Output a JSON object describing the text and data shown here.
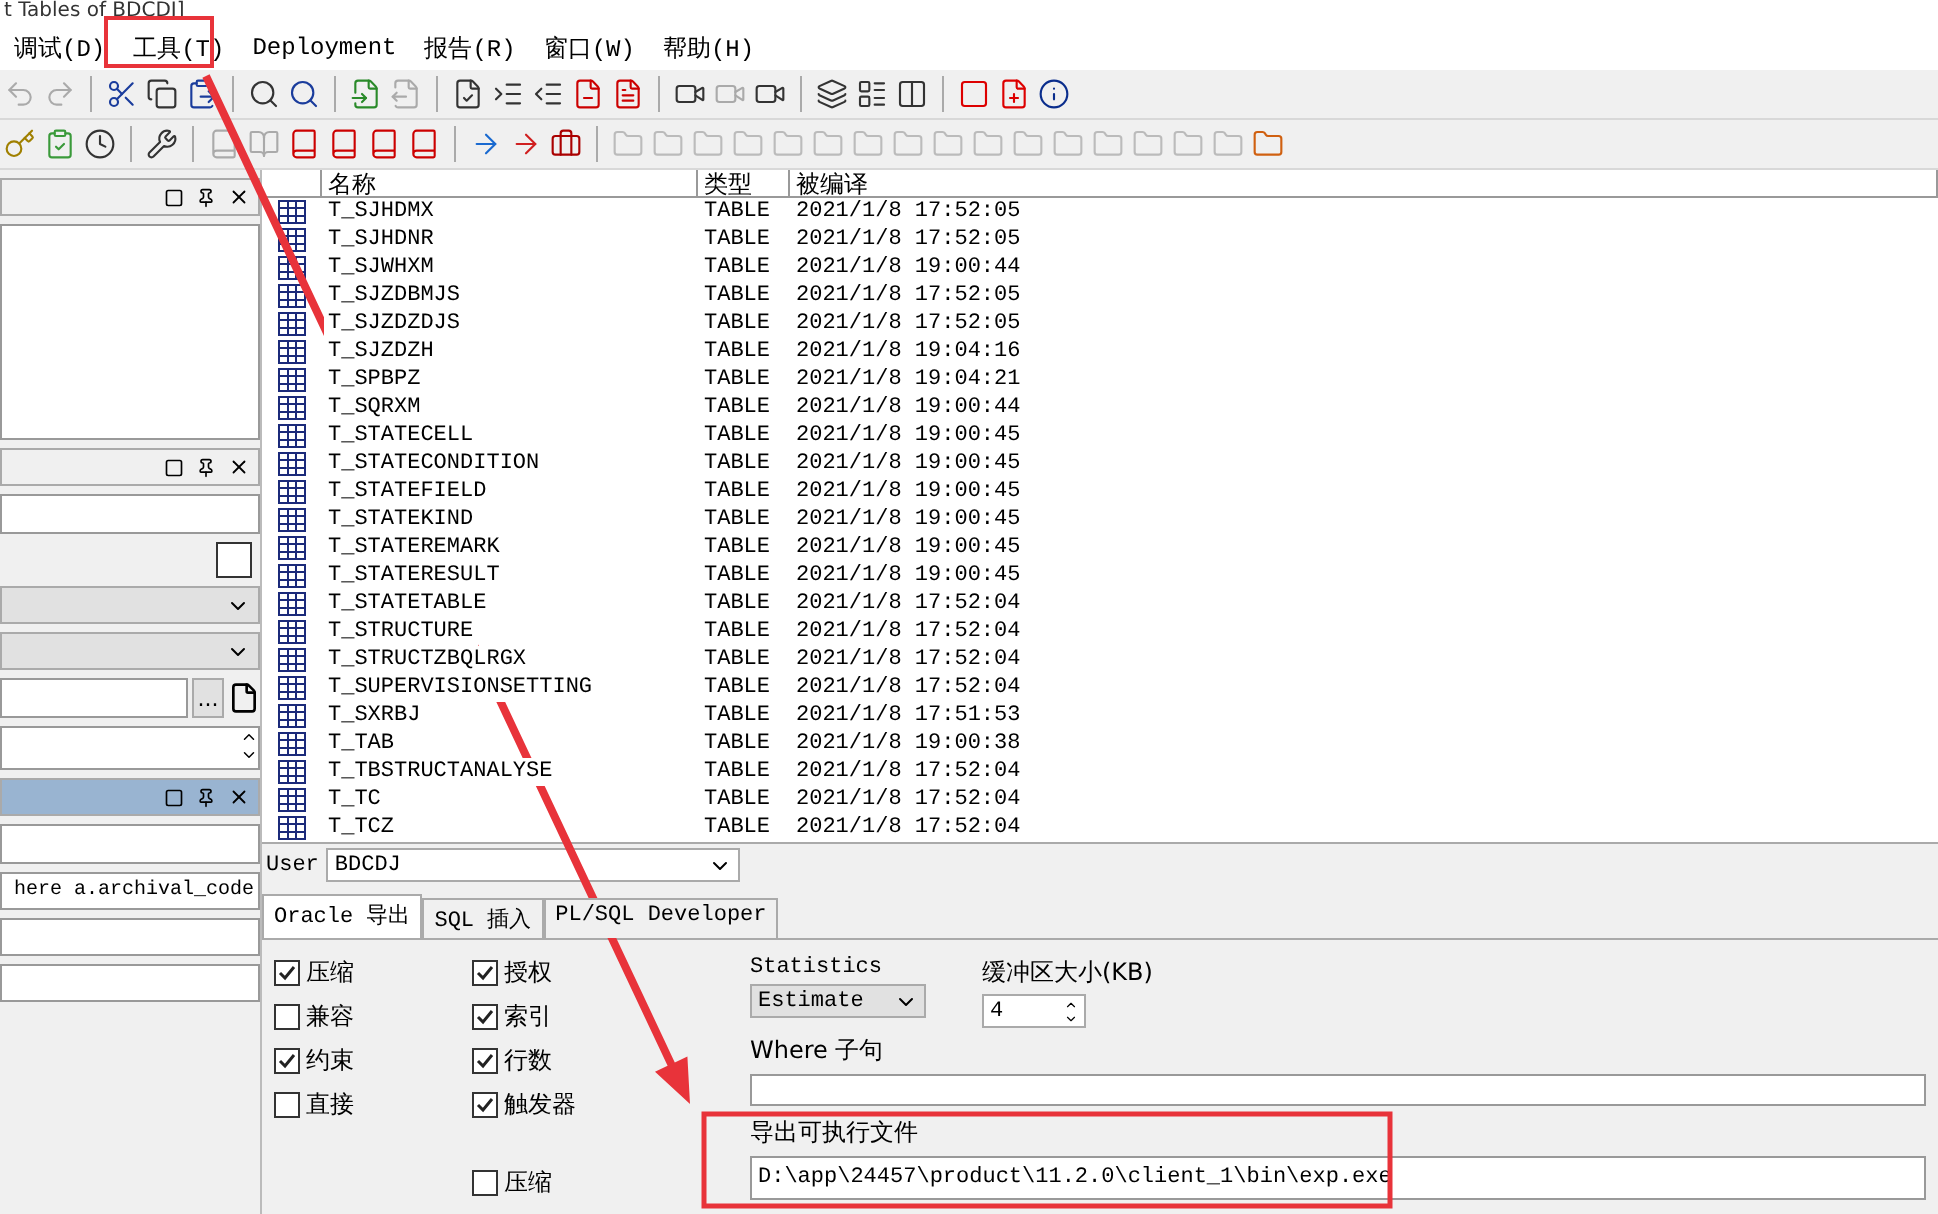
{
  "window": {
    "title": "t Tables of BDCDJ]"
  },
  "menu": [
    "调试(D)",
    "工具(T)",
    "Deployment",
    "报告(R)",
    "窗口(W)",
    "帮助(H)"
  ],
  "left_panels": [
    {
      "selected": false
    },
    {
      "selected": false,
      "checked": false,
      "browse_button": "..."
    },
    {
      "selected": true,
      "sql_text": "here a.archival_code"
    }
  ],
  "table": {
    "columns": [
      "名称",
      "类型",
      "被编译"
    ],
    "rows": [
      [
        "T_SJHDMX",
        "TABLE",
        "2021/1/8 17:52:05"
      ],
      [
        "T_SJHDNR",
        "TABLE",
        "2021/1/8 17:52:05"
      ],
      [
        "T_SJWHXM",
        "TABLE",
        "2021/1/8 19:00:44"
      ],
      [
        "T_SJZDBMJS",
        "TABLE",
        "2021/1/8 17:52:05"
      ],
      [
        "T_SJZDZDJS",
        "TABLE",
        "2021/1/8 17:52:05"
      ],
      [
        "T_SJZDZH",
        "TABLE",
        "2021/1/8 19:04:16"
      ],
      [
        "T_SPBPZ",
        "TABLE",
        "2021/1/8 19:04:21"
      ],
      [
        "T_SQRXM",
        "TABLE",
        "2021/1/8 19:00:44"
      ],
      [
        "T_STATECELL",
        "TABLE",
        "2021/1/8 19:00:45"
      ],
      [
        "T_STATECONDITION",
        "TABLE",
        "2021/1/8 19:00:45"
      ],
      [
        "T_STATEFIELD",
        "TABLE",
        "2021/1/8 19:00:45"
      ],
      [
        "T_STATEKIND",
        "TABLE",
        "2021/1/8 19:00:45"
      ],
      [
        "T_STATEREMARK",
        "TABLE",
        "2021/1/8 19:00:45"
      ],
      [
        "T_STATERESULT",
        "TABLE",
        "2021/1/8 19:00:45"
      ],
      [
        "T_STATETABLE",
        "TABLE",
        "2021/1/8 17:52:04"
      ],
      [
        "T_STRUCTURE",
        "TABLE",
        "2021/1/8 17:52:04"
      ],
      [
        "T_STRUCTZBQLRGX",
        "TABLE",
        "2021/1/8 17:52:04"
      ],
      [
        "T_SUPERVISIONSETTING",
        "TABLE",
        "2021/1/8 17:52:04"
      ],
      [
        "T_SXRBJ",
        "TABLE",
        "2021/1/8 17:51:53"
      ],
      [
        "T_TAB",
        "TABLE",
        "2021/1/8 19:00:38"
      ],
      [
        "T_TBSTRUCTANALYSE",
        "TABLE",
        "2021/1/8 17:52:04"
      ],
      [
        "T_TC",
        "TABLE",
        "2021/1/8 17:52:04"
      ],
      [
        "T_TCZ",
        "TABLE",
        "2021/1/8 17:52:04"
      ]
    ]
  },
  "user": {
    "label": "User",
    "value": "BDCDJ"
  },
  "tabs": [
    {
      "label": "Oracle 导出",
      "selected": true
    },
    {
      "label": "SQL 插入",
      "selected": false
    },
    {
      "label": "PL/SQL Developer",
      "selected": false
    }
  ],
  "options_left": [
    {
      "label": "压缩",
      "checked": true
    },
    {
      "label": "兼容",
      "checked": false
    },
    {
      "label": "约束",
      "checked": true
    },
    {
      "label": "直接",
      "checked": false
    }
  ],
  "options_right": [
    {
      "label": "授权",
      "checked": true
    },
    {
      "label": "索引",
      "checked": true
    },
    {
      "label": "行数",
      "checked": true
    },
    {
      "label": "触发器",
      "checked": true
    }
  ],
  "extra_option": {
    "label": "压缩",
    "checked": false
  },
  "statistics": {
    "label": "Statistics",
    "value": "Estimate"
  },
  "buffer": {
    "label": "缓冲区大小(KB)",
    "value": "4"
  },
  "where": {
    "label": "Where 子句"
  },
  "output_file": {
    "label": "导出可执行文件",
    "value": "D:\\app\\24457\\product\\11.2.0\\client_1\\bin\\exp.exe"
  }
}
